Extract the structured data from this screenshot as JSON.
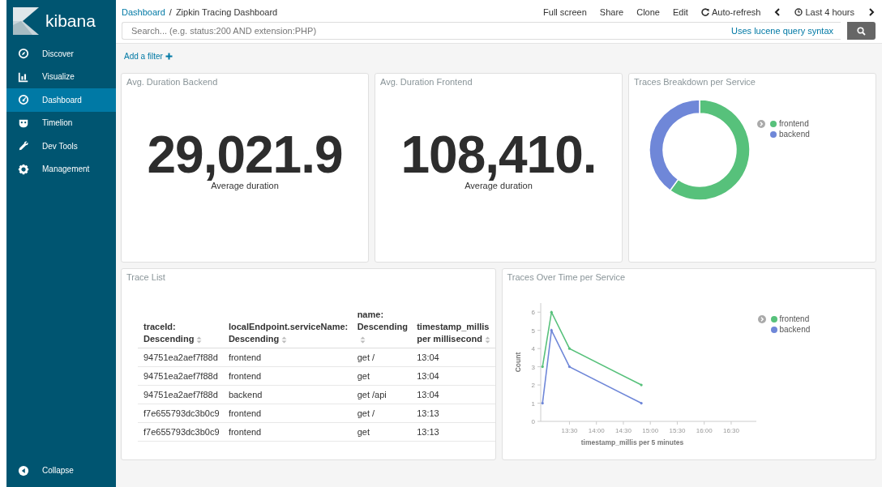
{
  "sidebar": {
    "logo_text": "kibana",
    "items": [
      {
        "label": "Discover",
        "selected": false
      },
      {
        "label": "Visualize",
        "selected": false
      },
      {
        "label": "Dashboard",
        "selected": true
      },
      {
        "label": "Timelion",
        "selected": false
      },
      {
        "label": "Dev Tools",
        "selected": false
      },
      {
        "label": "Management",
        "selected": false
      }
    ],
    "collapse": "Collapse"
  },
  "breadcrumbs": {
    "link": "Dashboard",
    "separator": "/",
    "current": "Zipkin Tracing Dashboard"
  },
  "actions": [
    "Full screen",
    "Share",
    "Clone",
    "Edit"
  ],
  "auto_refresh": "Auto-refresh",
  "time_range": "Last 4 hours",
  "search": {
    "placeholder": "Search... (e.g. status:200 AND extension:PHP)",
    "syntax_link": "Uses lucene query syntax"
  },
  "add_filter": "Add a filter",
  "panels": [
    {
      "kind": "metric",
      "title": "Avg. Duration Backend",
      "value": "29,021.9",
      "label": "Average duration"
    },
    {
      "kind": "metric",
      "title": "Avg. Duration Frontend",
      "value": "108,410.",
      "label": "Average duration"
    },
    {
      "kind": "chart",
      "title": "Traces Breakdown per Service",
      "chart_data": {
        "type": "donut",
        "legend": "right",
        "categories": [
          "frontend",
          "backend"
        ],
        "values": [
          60,
          40
        ],
        "colors": [
          "#57c17b",
          "#6f87d8"
        ]
      }
    },
    {
      "kind": "table",
      "title": "Trace List",
      "columns": [
        "traceId: Descending",
        "localEndpoint.serviceName: Descending",
        "name: Descending",
        "timestamp_millis per millisecond"
      ],
      "rows": [
        [
          "94751ea2aef7f88d",
          "frontend",
          "get /",
          "13:04"
        ],
        [
          "94751ea2aef7f88d",
          "frontend",
          "get",
          "13:04"
        ],
        [
          "94751ea2aef7f88d",
          "backend",
          "get /api",
          "13:04"
        ],
        [
          "f7e655793dc3b0c9",
          "frontend",
          "get /",
          "13:13"
        ],
        [
          "f7e655793dc3b0c9",
          "frontend",
          "get",
          "13:13"
        ]
      ]
    },
    {
      "kind": "chart",
      "title": "Traces Over Time per Service",
      "chart_data": {
        "type": "line",
        "legend": "right",
        "xlabel": "timestamp_millis per 5 minutes",
        "ylabel": "Count",
        "x": [
          780,
          790,
          810,
          890
        ],
        "series": [
          {
            "name": "frontend",
            "color": "#57c17b",
            "values": [
              3,
              6,
              4,
              2
            ]
          },
          {
            "name": "backend",
            "color": "#6f87d8",
            "values": [
              1,
              5,
              3,
              1
            ]
          }
        ],
        "xlim": [
          778,
          1018
        ],
        "ylim": [
          0,
          6.5
        ],
        "xticks": [
          {
            "value": 810,
            "label": "13:30"
          },
          {
            "value": 840,
            "label": "14:00"
          },
          {
            "value": 870,
            "label": "14:30"
          },
          {
            "value": 900,
            "label": "15:00"
          },
          {
            "value": 930,
            "label": "15:30"
          },
          {
            "value": 960,
            "label": "16:00"
          },
          {
            "value": 990,
            "label": "16:30"
          }
        ],
        "yticks": [
          0,
          1,
          2,
          3,
          4,
          5,
          6
        ]
      }
    }
  ]
}
